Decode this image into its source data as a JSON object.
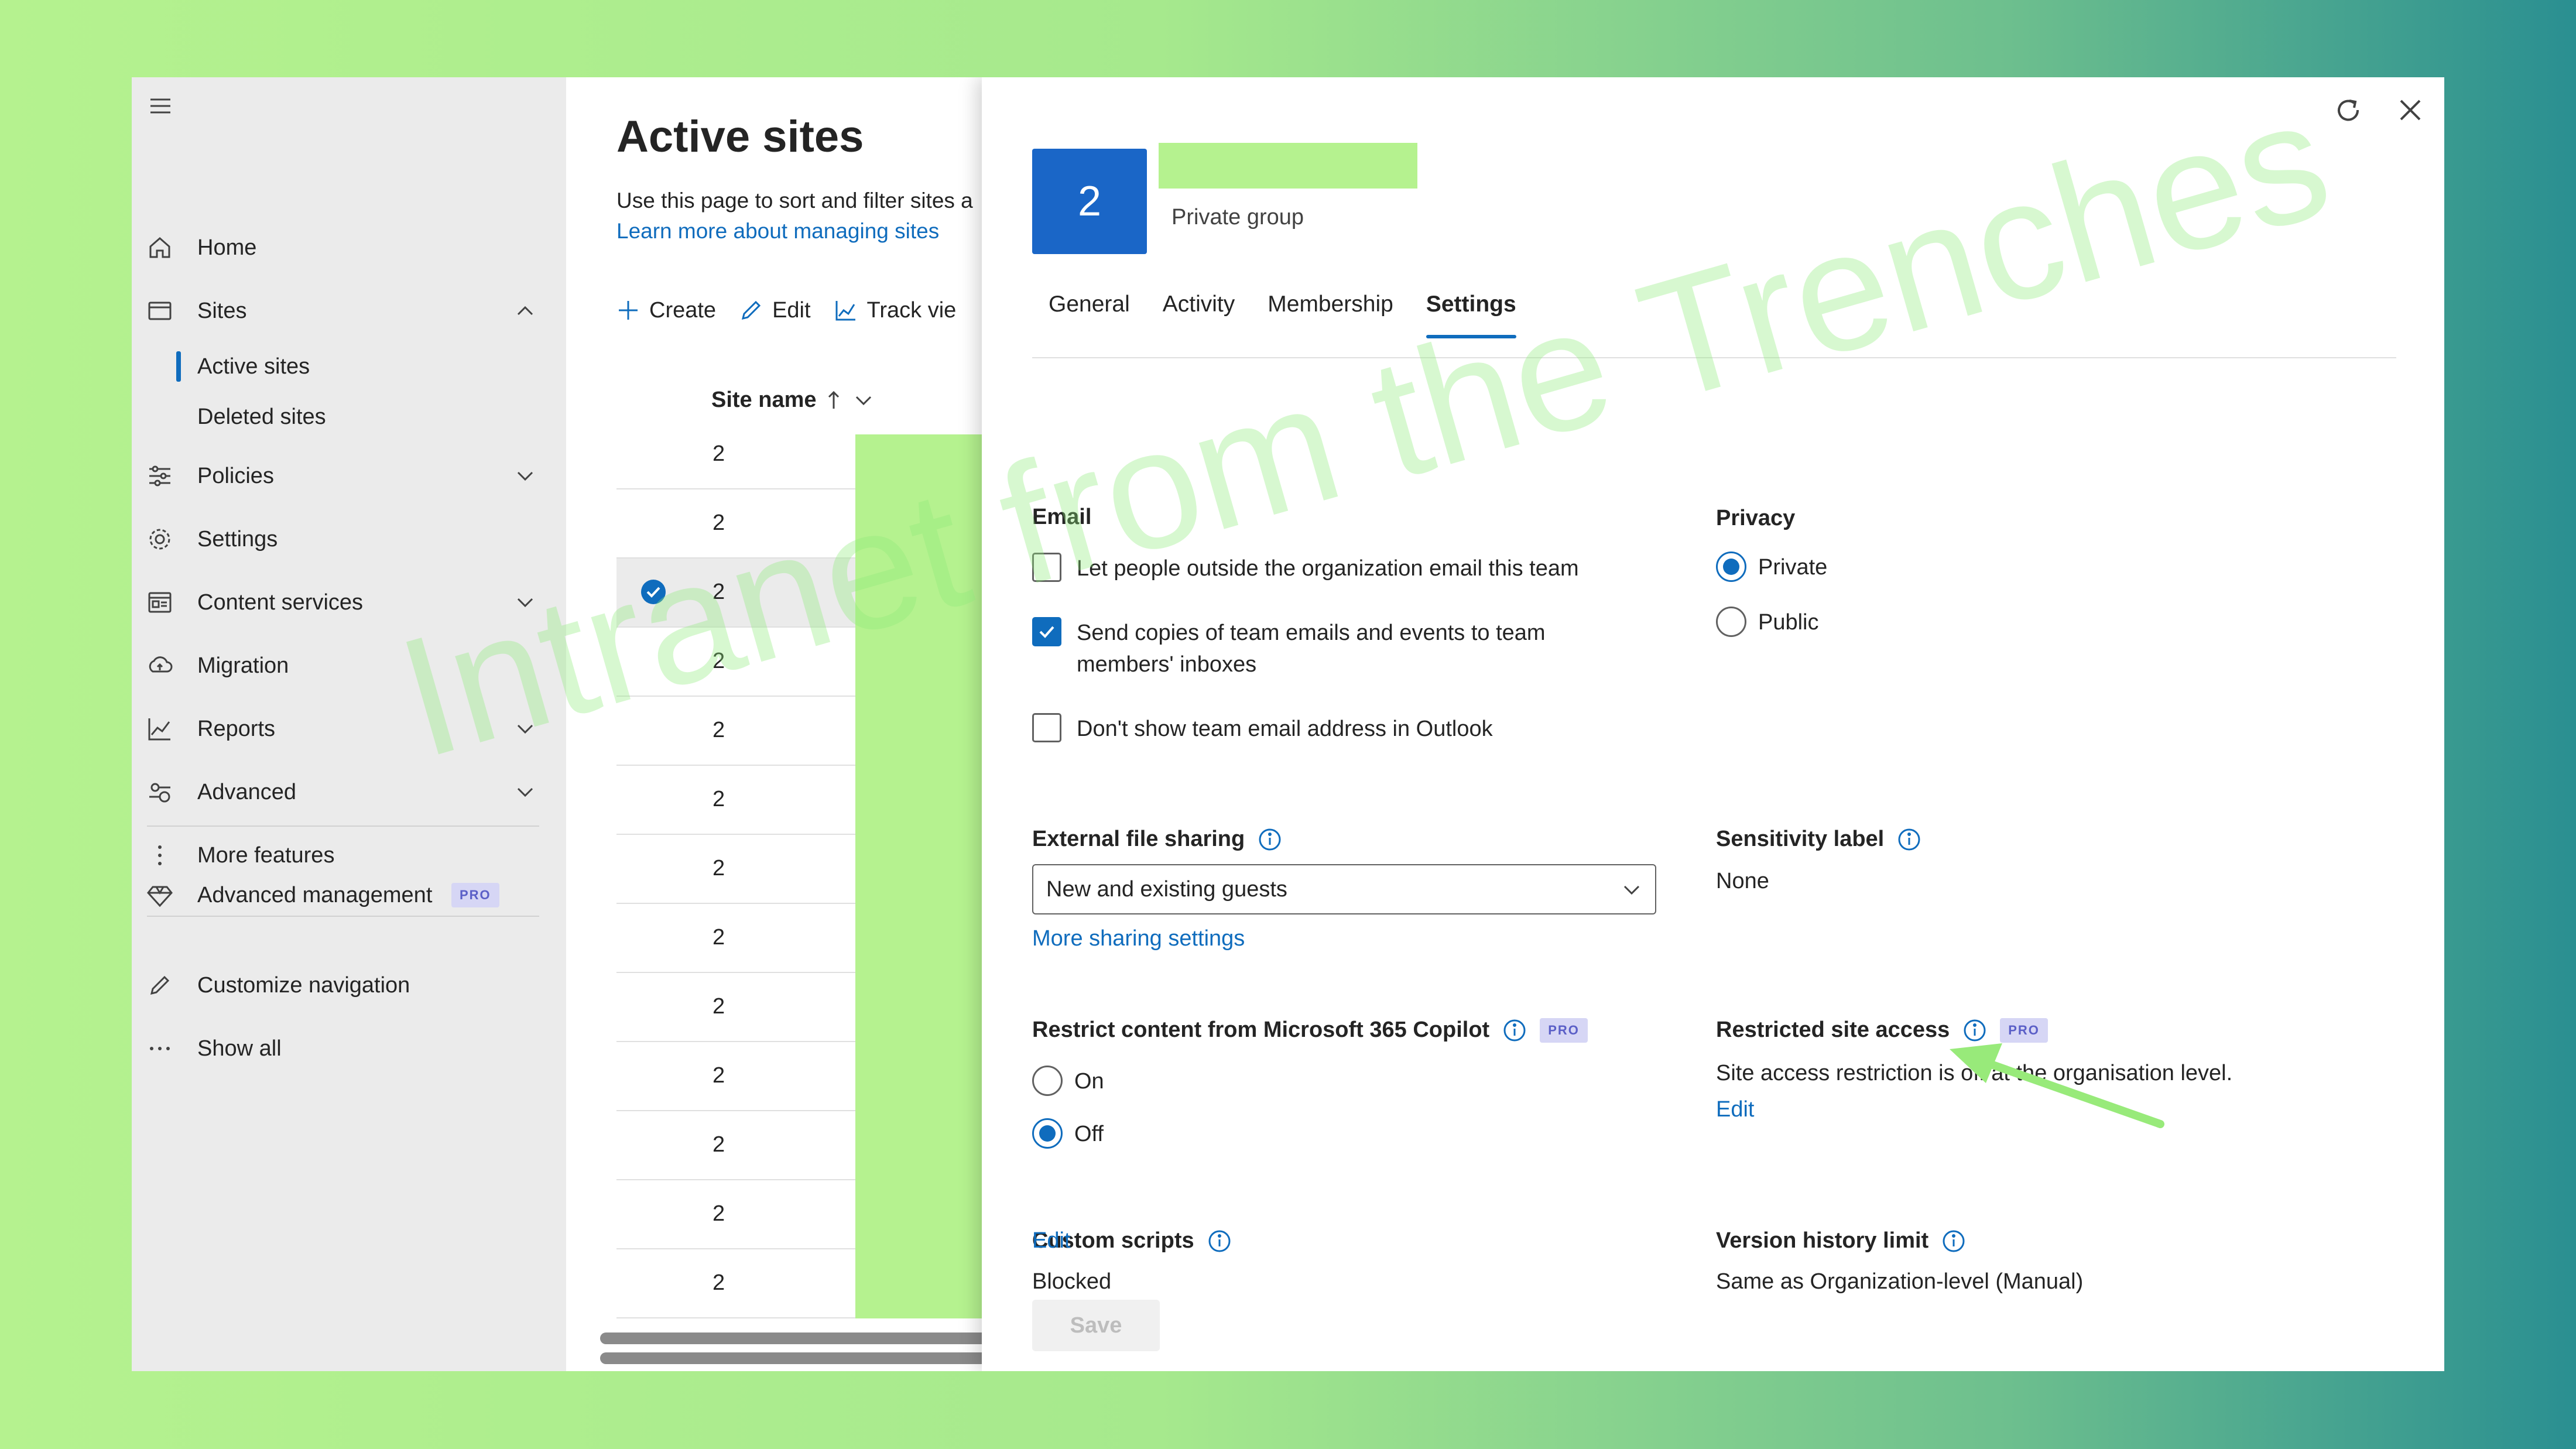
{
  "nav": {
    "items": [
      {
        "label": "Home",
        "icon": "home-icon"
      },
      {
        "label": "Sites",
        "icon": "sites-icon",
        "expanded": true
      },
      {
        "label": "Policies",
        "icon": "policies-icon"
      },
      {
        "label": "Settings",
        "icon": "settings-icon"
      },
      {
        "label": "Content services",
        "icon": "content-services-icon"
      },
      {
        "label": "Migration",
        "icon": "migration-icon"
      },
      {
        "label": "Reports",
        "icon": "reports-icon"
      },
      {
        "label": "Advanced",
        "icon": "advanced-icon"
      },
      {
        "label": "More features",
        "icon": "more-features-icon"
      },
      {
        "label": "Advanced management",
        "icon": "diamond-icon",
        "badge": "PRO"
      },
      {
        "label": "Customize navigation",
        "icon": "pencil-icon"
      },
      {
        "label": "Show all",
        "icon": "ellipsis-icon"
      }
    ],
    "sites_sub": [
      "Active sites",
      "Deleted sites"
    ]
  },
  "main": {
    "title": "Active sites",
    "description": "Use this page to sort and filter sites a",
    "learn_more": "Learn more about managing sites",
    "toolbar": {
      "create": "Create",
      "edit": "Edit",
      "track": "Track vie"
    },
    "column_header": "Site name",
    "row_cells": [
      "2",
      "2",
      "2",
      "2",
      "2",
      "2",
      "2",
      "2",
      "2",
      "2",
      "2",
      "2",
      "2"
    ],
    "selected_row_index": 2
  },
  "panel": {
    "avatar_text": "2",
    "group_type": "Private group",
    "tabs": [
      "General",
      "Activity",
      "Membership",
      "Settings"
    ],
    "active_tab": "Settings",
    "email": {
      "heading": "Email",
      "options": [
        {
          "label": "Let people outside the organization email this team",
          "checked": false
        },
        {
          "label_line1": "Send copies of team emails and events to team",
          "label_line2": "members' inboxes",
          "checked": true
        },
        {
          "label": "Don't show team email address in Outlook",
          "checked": false
        }
      ]
    },
    "privacy": {
      "heading": "Privacy",
      "options": [
        "Private",
        "Public"
      ],
      "selected": "Private"
    },
    "external_sharing": {
      "heading": "External file sharing",
      "value": "New and existing guests",
      "more_link": "More sharing settings"
    },
    "sensitivity": {
      "heading": "Sensitivity label",
      "value": "None"
    },
    "copilot": {
      "heading": "Restrict content from Microsoft 365 Copilot",
      "badge": "PRO",
      "options": [
        "On",
        "Off"
      ],
      "selected": "Off"
    },
    "restricted_access": {
      "heading": "Restricted site access",
      "badge": "PRO",
      "value": "Site access restriction is off at the organisation level.",
      "edit": "Edit"
    },
    "custom_scripts": {
      "heading": "Custom scripts",
      "value": "Blocked",
      "edit": "Edit"
    },
    "version_history": {
      "heading": "Version history limit",
      "value": "Same as Organization-level (Manual)"
    },
    "save": "Save"
  },
  "watermark": "Intranet from the Trenches",
  "colors": {
    "accent": "#0f6cbd",
    "avatar": "#1a66c7",
    "nav_bg": "#ebebeb",
    "redaction": "#b5f28f",
    "pro_badge_bg": "#d6d6f5",
    "pro_badge_text": "#5b5fc7"
  }
}
